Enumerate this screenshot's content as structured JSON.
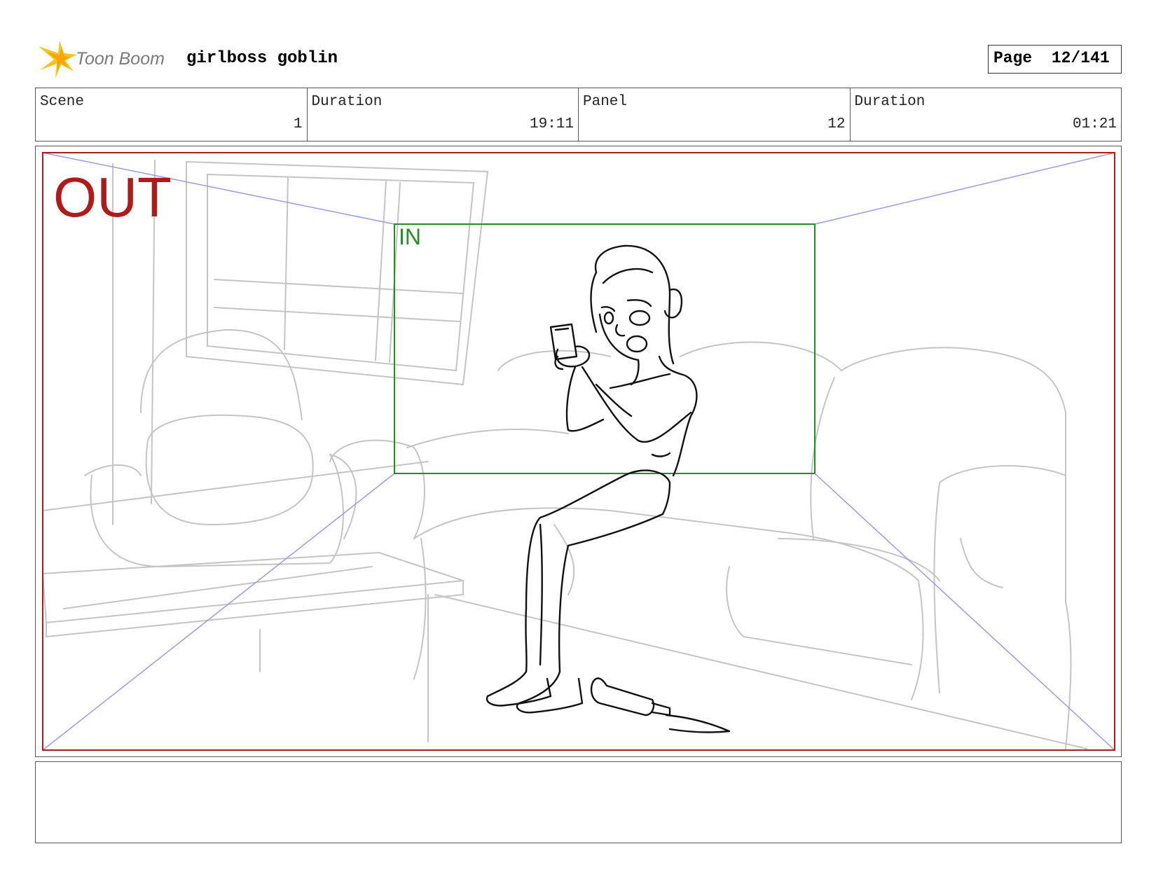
{
  "header": {
    "logo_text": "Toon Boom",
    "project_title": "girlboss goblin",
    "page_label": "Page",
    "page_number": "12/141"
  },
  "info": {
    "scene_label": "Scene",
    "scene_value": "1",
    "scene_duration_label": "Duration",
    "scene_duration_value": "19:11",
    "panel_label": "Panel",
    "panel_value": "12",
    "panel_duration_label": "Duration",
    "panel_duration_value": "01:21"
  },
  "panel": {
    "out_label": "OUT",
    "in_label": "IN",
    "out_color": "#b01a1a",
    "in_color": "#2a8a2a",
    "guide_color": "#9a9ae0"
  },
  "caption": {
    "text": ""
  }
}
